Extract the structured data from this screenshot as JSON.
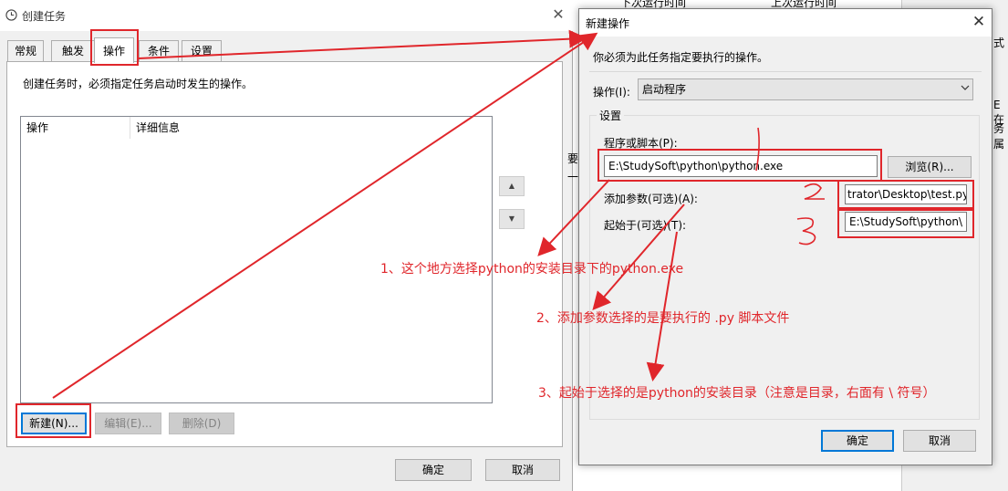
{
  "background_window": {
    "header_col1": "下次运行时间",
    "header_col2": "上次运行时间",
    "fragments": [
      "式",
      "E在",
      "务属"
    ],
    "left_fragments": [
      "一",
      "要"
    ]
  },
  "create_task_window": {
    "title": "创建任务",
    "close_glyph": "✕",
    "tabs": [
      "常规",
      "触发器",
      "操作",
      "条件",
      "设置"
    ],
    "active_tab": "操作",
    "description": "创建任务时，必须指定任务启动时发生的操作。",
    "list_columns": [
      "操作",
      "详细信息"
    ],
    "scroll_up": "▲",
    "scroll_down": "▼",
    "buttons": {
      "new": "新建(N)...",
      "edit": "编辑(E)...",
      "delete": "删除(D)"
    },
    "ok": "确定",
    "cancel": "取消"
  },
  "new_action_dialog": {
    "title": "新建操作",
    "close_glyph": "✕",
    "hint": "你必须为此任务指定要执行的操作。",
    "action_label": "操作(I):",
    "action_value": "启动程序",
    "settings_group": "设置",
    "program_label": "程序或脚本(P):",
    "program_value": "E:\\StudySoft\\python\\python.exe",
    "browse": "浏览(R)...",
    "args_label": "添加参数(可选)(A):",
    "args_value": "trator\\Desktop\\test.py",
    "start_label": "起始于(可选)(T):",
    "start_value": "E:\\StudySoft\\python\\",
    "ok": "确定",
    "cancel": "取消"
  },
  "annotations": {
    "note1": "1、这个地方选择python的安装目录下的python.exe",
    "note2": "2、添加参数选择的是要执行的 .py 脚本文件",
    "note3": "3、起始于选择的是python的安装目录（注意是目录，右面有 \\ 符号）",
    "hand_1": "1",
    "hand_2": "2",
    "hand_3": "3"
  },
  "colors": {
    "annotation_red": "#e0262b",
    "focus_blue": "#0078d7"
  }
}
